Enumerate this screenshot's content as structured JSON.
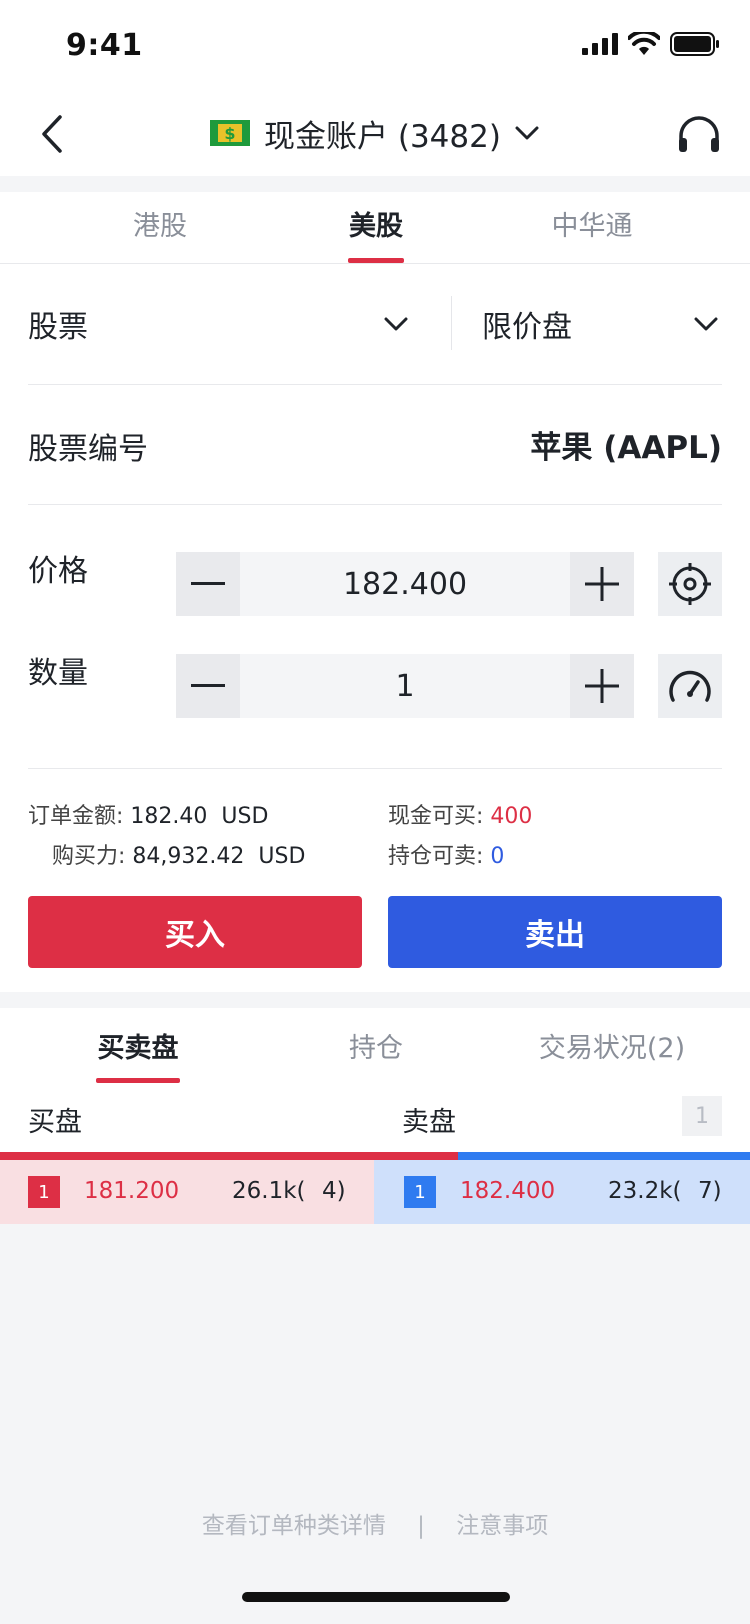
{
  "status_bar": {
    "time": "9:41"
  },
  "nav": {
    "account_title": "现金账户 (3482)"
  },
  "market_tabs": [
    {
      "label": "港股"
    },
    {
      "label": "美股",
      "active": true
    },
    {
      "label": "中华通"
    }
  ],
  "form": {
    "product_type": "股票",
    "order_type": "限价盘",
    "code_label": "股票编号",
    "code_value": "苹果 (AAPL)",
    "price_label": "价格",
    "price_value": "182.400",
    "qty_label": "数量",
    "qty_value": "1",
    "order_amount_label": "订单金额:",
    "order_amount_value": "182.40  USD",
    "buying_power_label": "购买力:",
    "buying_power_value": "84,932.42  USD",
    "cash_buyable_label": "现金可买:",
    "cash_buyable_value": "400",
    "position_sellable_label": "持仓可卖:",
    "position_sellable_value": "0",
    "buy_label": "买入",
    "sell_label": "卖出"
  },
  "bottom_tabs": [
    {
      "label": "买卖盘",
      "active": true
    },
    {
      "label": "持仓"
    },
    {
      "label": "交易状况(2)"
    }
  ],
  "order_book": {
    "bid_header": "买盘",
    "ask_header": "卖盘",
    "depth": "1",
    "bid": {
      "level": "1",
      "price": "181.200",
      "volume": "26.1k(",
      "count": "4)"
    },
    "ask": {
      "level": "1",
      "price": "182.400",
      "volume": "23.2k(",
      "count": "7)"
    },
    "bid_share": 0.61
  },
  "footer": {
    "link_order_types": "查看订单种类详情",
    "separator": "|",
    "link_notes": "注意事项"
  },
  "colors": {
    "buy": "#dd2f45",
    "sell": "#2f5be0",
    "ask_bar": "#2f7bf0"
  },
  "icons": [
    "back-icon",
    "cash-flag-icon",
    "chevron-down-icon",
    "headset-icon",
    "minus-icon",
    "plus-icon",
    "target-icon",
    "speedometer-icon"
  ]
}
